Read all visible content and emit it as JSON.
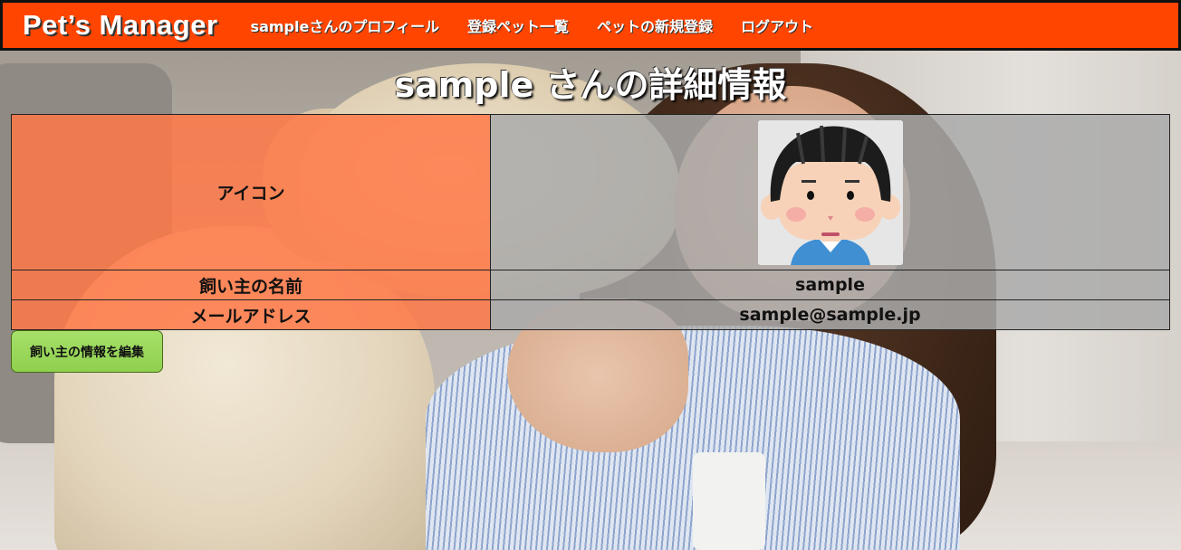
{
  "header": {
    "brand": "Pet’s Manager",
    "nav": [
      {
        "label": "sampleさんのプロフィール"
      },
      {
        "label": "登録ペット一覧"
      },
      {
        "label": "ペットの新規登録"
      },
      {
        "label": "ログアウト"
      }
    ],
    "bg_color": "#ff4500"
  },
  "main": {
    "title": "sample さんの詳細情報",
    "rows": [
      {
        "label": "アイコン",
        "value": ""
      },
      {
        "label": "飼い主の名前",
        "value": "sample"
      },
      {
        "label": "メールアドレス",
        "value": "sample@sample.jp"
      }
    ],
    "edit_button_label": "飼い主の情報を編集"
  },
  "colors": {
    "label_cell": "#ff7846",
    "value_cell": "#aaaaaa",
    "edit_button": "#9ad85c"
  }
}
